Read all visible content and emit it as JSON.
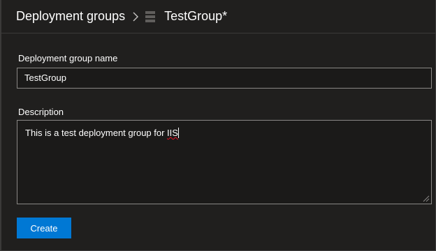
{
  "breadcrumb": {
    "parent_label": "Deployment groups",
    "current_label": "TestGroup*"
  },
  "form": {
    "name_label": "Deployment group name",
    "name_value": "TestGroup",
    "description_label": "Description",
    "description_text_before": "This is a test deployment group for ",
    "description_text_misspelled": "IIS"
  },
  "actions": {
    "create_label": "Create"
  },
  "colors": {
    "background": "#201f1e",
    "accent": "#0078d4",
    "border": "#8a8886",
    "spellcheck": "#e81123"
  },
  "icons": {
    "separator": "chevron-right-icon",
    "group": "deployment-group-icon",
    "resize": "resize-grip-icon"
  }
}
